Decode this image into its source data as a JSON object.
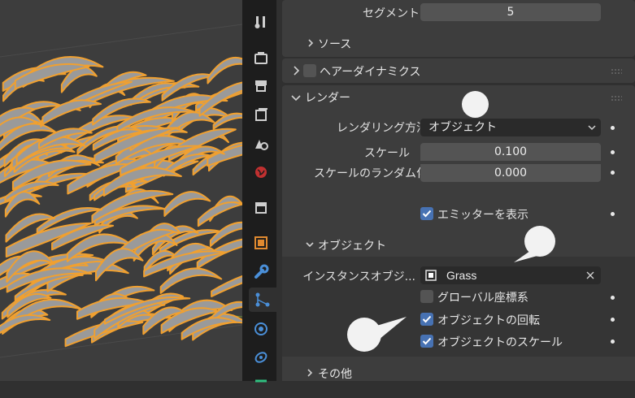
{
  "props": {
    "segments": {
      "label": "セグメント",
      "value": "5"
    },
    "source": {
      "label": "ソース"
    },
    "hair_dynamics": {
      "label": "ヘアーダイナミクス"
    },
    "render": {
      "label": "レンダー",
      "render_as": {
        "label": "レンダリング方法",
        "value": "オブジェクト"
      },
      "scale": {
        "label": "スケール",
        "value": "0.100"
      },
      "scale_random": {
        "label": "スケールのランダム化",
        "value": "0.000"
      },
      "show_emitter": {
        "label": "エミッターを表示",
        "checked": true
      },
      "object": {
        "label": "オブジェクト",
        "instance_object": {
          "label": "インスタンスオブジ...",
          "value": "Grass"
        },
        "global_coords": {
          "label": "グローバル座標系",
          "checked": false
        },
        "object_rotation": {
          "label": "オブジェクトの回転",
          "checked": true
        },
        "object_scale": {
          "label": "オブジェクトのスケール",
          "checked": true
        }
      }
    },
    "other": {
      "label": "その他"
    }
  },
  "colors": {
    "accent": "#4772b3",
    "hair_outline": "#f0a030",
    "panel": "#3d3d3d"
  }
}
